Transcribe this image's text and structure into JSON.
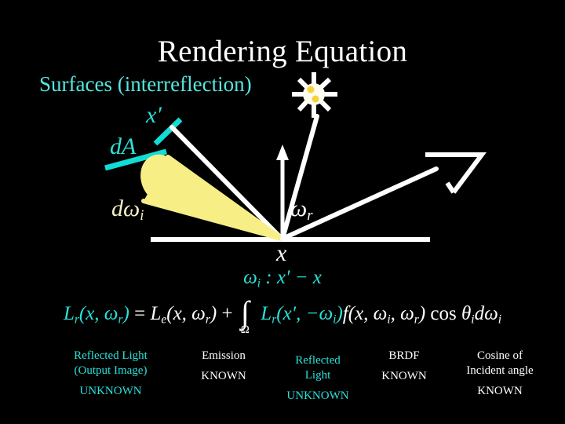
{
  "slide": {
    "background_color": "#000000",
    "title": "Rendering Equation",
    "title_color": "#ffffff",
    "subtitle": "Surfaces (interreflection)",
    "subtitle_color": "#2ce0d8"
  },
  "diagram": {
    "labels": {
      "x_prime": "x′",
      "dA": "dA",
      "d_omega_i": "dω",
      "d_omega_i_sub": "i",
      "omega_r": "ω",
      "omega_r_sub": "r",
      "x": "x"
    },
    "icons": {
      "light_source": "sun-icon",
      "viewer": "eye-icon",
      "normal": "normal-arrow-icon"
    },
    "colors": {
      "cyan": "#2ce0d8",
      "yellow": "#f7ef86",
      "white": "#ffffff",
      "cream": "#f6f0c8"
    }
  },
  "wi_annotation": {
    "omega": "ω",
    "sub": "i",
    "colon": " :  ",
    "expr": "x′ − x"
  },
  "equation": {
    "lhs": "L",
    "lhs_sub": "r",
    "lhs_args": "(x, ω",
    "lhs_args_sub": "r",
    "lhs_args_end": ")",
    "equals": " = ",
    "emission": "L",
    "emission_sub": "e",
    "emission_args": "(x, ω",
    "emission_args_sub": "r",
    "emission_args_end": ")",
    "plus": " + ",
    "integral": "∫",
    "integral_domain": "Ω",
    "radiance_in": "L",
    "radiance_in_sub": "r",
    "radiance_in_args": "(x′, −ω",
    "radiance_in_args_sub": "i",
    "radiance_in_args_end": ")",
    "brdf": "f",
    "brdf_args": "(x, ω",
    "brdf_args_sub1": "i",
    "brdf_args_mid": ", ω",
    "brdf_args_sub2": "r",
    "brdf_args_end": ")",
    "cosine": " cos ",
    "theta": "θ",
    "theta_sub": "i",
    "differential": "dω",
    "differential_sub": "i"
  },
  "legend": {
    "columns": [
      {
        "term": "Reflected Light",
        "term_line2": "(Output Image)",
        "status": "UNKNOWN",
        "color": "#2ce0d8"
      },
      {
        "term": "Emission",
        "term_line2": "",
        "status": "KNOWN",
        "color": "#ffffff"
      },
      {
        "term": "Reflected",
        "term_line2": "Light",
        "status": "UNKNOWN",
        "color": "#2ce0d8"
      },
      {
        "term": "BRDF",
        "term_line2": "",
        "status": "KNOWN",
        "color": "#ffffff"
      },
      {
        "term": "Cosine of",
        "term_line2": "Incident angle",
        "status": "KNOWN",
        "color": "#ffffff"
      }
    ]
  }
}
